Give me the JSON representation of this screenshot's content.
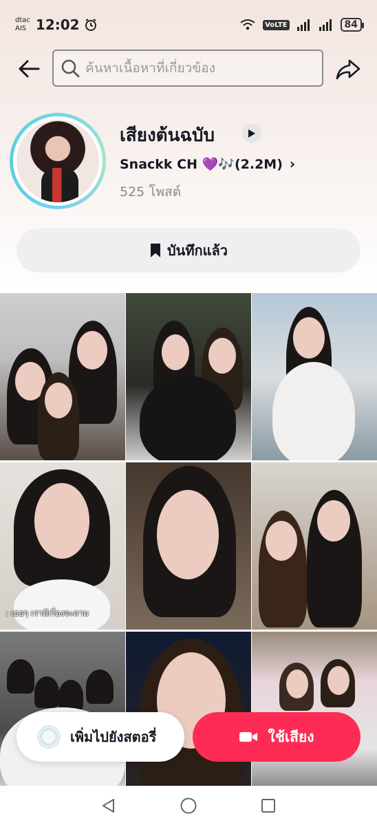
{
  "status_bar": {
    "carrier_top": "dtac",
    "carrier_bottom": "AIS",
    "time": "12:02",
    "volte": "VoLTE",
    "battery": "84"
  },
  "header": {
    "search_placeholder": "ค้นหาเนื้อหาที่เกี่ยวข้อง"
  },
  "sound": {
    "title": "เสียงต้นฉบับ",
    "author": "Snackk CH 💜🎶(2.2M)",
    "post_count": "525 โพสต์",
    "saved_label": "บันทึกแล้ว"
  },
  "grid": {
    "captions": {
      "tile_4": ": เธอๆ เรามีเรื่องจะถาม"
    }
  },
  "actions": {
    "add_to_story_label": "เพิ่มไปยังสตอรี่",
    "use_sound_label": "ใช้เสียง"
  },
  "colors": {
    "accent": "#fe2c55",
    "avatar_ring": "#6fd6e8"
  },
  "icons": {
    "back": "arrow-left-icon",
    "search": "search-icon",
    "share": "share-icon",
    "play": "play-icon",
    "bookmark": "bookmark-icon",
    "camera": "video-camera-icon"
  }
}
